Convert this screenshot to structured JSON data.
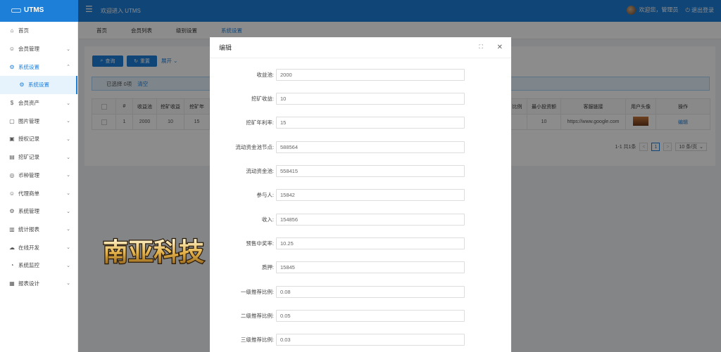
{
  "header": {
    "app_title": "UTMS",
    "menu_icon": "menu-fold-icon",
    "welcome": "欢迎进入 UTMS",
    "user_greeting": "欢迎您，管理员",
    "logout": "退出登录"
  },
  "sidebar": {
    "items": [
      {
        "label": "首页",
        "icon": "home-icon",
        "chev": ""
      },
      {
        "label": "会员管理",
        "icon": "user-icon",
        "chev": "⌄"
      },
      {
        "label": "系统设置",
        "icon": "gear-icon",
        "chev": "⌃"
      },
      {
        "label": "系统设置",
        "icon": "gear-icon",
        "chev": ""
      },
      {
        "label": "会员资产",
        "icon": "wallet-icon",
        "chev": "⌄"
      },
      {
        "label": "图片管理",
        "icon": "image-icon",
        "chev": "⌄"
      },
      {
        "label": "授权记录",
        "icon": "record-icon",
        "chev": "⌄"
      },
      {
        "label": "挖矿记录",
        "icon": "mining-icon",
        "chev": "⌄"
      },
      {
        "label": "币种管理",
        "icon": "coin-icon",
        "chev": "⌄"
      },
      {
        "label": "代理商单",
        "icon": "agent-icon",
        "chev": "⌄"
      },
      {
        "label": "系统管理",
        "icon": "gear-icon",
        "chev": "⌄"
      },
      {
        "label": "统计报表",
        "icon": "chart-icon",
        "chev": "⌄"
      },
      {
        "label": "在线开发",
        "icon": "cloud-icon",
        "chev": "⌄"
      },
      {
        "label": "系统监控",
        "icon": "monitor-icon",
        "chev": "⌄"
      },
      {
        "label": "报表设计",
        "icon": "report-icon",
        "chev": "⌄"
      }
    ]
  },
  "tabs": [
    {
      "label": "首页"
    },
    {
      "label": "会员列表"
    },
    {
      "label": "级别设置"
    },
    {
      "label": "系统设置"
    }
  ],
  "toolbar": {
    "query": "查询",
    "reset": "重置",
    "expand": "展开"
  },
  "alert": {
    "selected": "已选择 0项",
    "clear": "清空"
  },
  "table": {
    "left_headers": [
      "#",
      "收益池",
      "挖矿收益",
      "挖矿年"
    ],
    "left_row": [
      "1",
      "2000",
      "10",
      "15"
    ],
    "right_headers": [
      "比例",
      "最小投资额",
      "客服链接",
      "用户头像",
      "操作"
    ],
    "right_row": [
      "",
      "10",
      "https://www.google.com",
      "",
      "编辑"
    ]
  },
  "pagination": {
    "summary": "1-1 共1条",
    "prev": "<",
    "current": "1",
    "next": ">",
    "page_size": "10 条/页"
  },
  "modal": {
    "title": "编辑",
    "fields": [
      {
        "label": "收益池:",
        "value": "2000"
      },
      {
        "label": "挖矿收益:",
        "value": "10"
      },
      {
        "label": "挖矿年利率:",
        "value": "15"
      },
      {
        "label": "流动资金池节点:",
        "value": "588564"
      },
      {
        "label": "流动资金池:",
        "value": "558415"
      },
      {
        "label": "参与人:",
        "value": "15842"
      },
      {
        "label": "收入:",
        "value": "154856"
      },
      {
        "label": "预售中奖率:",
        "value": "10.25"
      },
      {
        "label": "质押:",
        "value": "15845"
      },
      {
        "label": "一级推荐比例:",
        "value": "0.08"
      },
      {
        "label": "二级推荐比例:",
        "value": "0.05"
      },
      {
        "label": "三级推荐比例:",
        "value": "0.03"
      }
    ]
  },
  "watermark": {
    "text": "南亚科技"
  },
  "colors": {
    "primary": "#1e7fd9",
    "alert_bg": "#e8f4fe"
  }
}
